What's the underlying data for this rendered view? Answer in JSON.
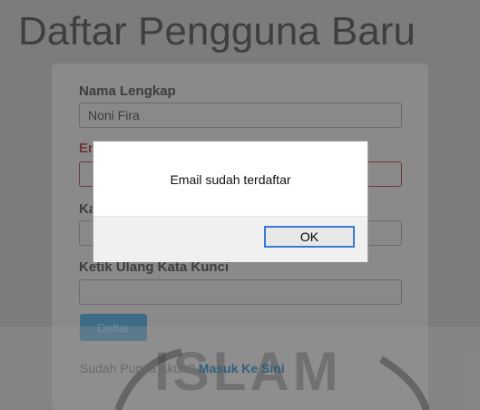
{
  "page": {
    "title": "Daftar Pengguna Baru"
  },
  "form": {
    "nama_label": "Nama Lengkap",
    "nama_value": "Noni Fira",
    "email_label": "Email",
    "kata_kunci_label": "Kata Kunci",
    "ulang_label": "Ketik Ulang Kata Kunci",
    "submit_label": "Daftar"
  },
  "footer": {
    "prompt": "Sudah Punya Akun?",
    "link": "Masuk Ke Sini",
    "watermark": "ISLAM"
  },
  "dialog": {
    "message": "Email sudah terdaftar",
    "ok_label": "OK"
  }
}
